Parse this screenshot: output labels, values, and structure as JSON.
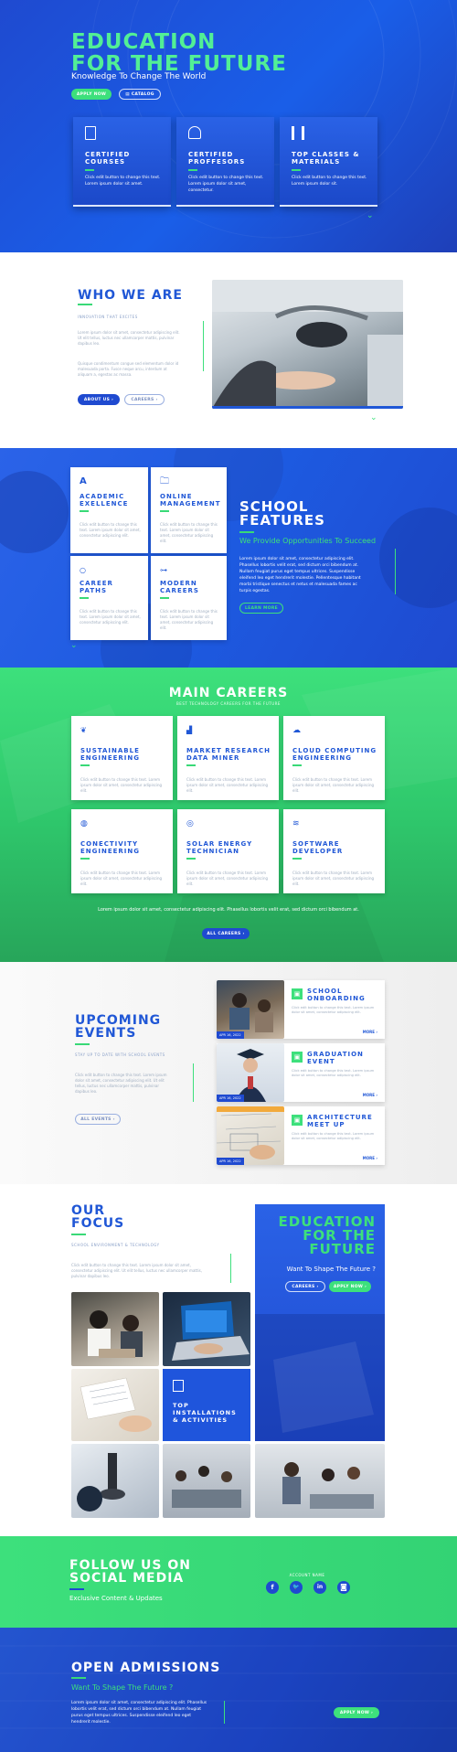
{
  "hero": {
    "title_1": "EDUCATION",
    "title_2": "FOR THE FUTURE",
    "subtitle": "Knowledge To Change The World",
    "btn_apply": "APPLY NOW",
    "btn_catalog": "CATALOG",
    "cards": [
      {
        "icon": "certificate-icon",
        "title_1": "CERTIFIED",
        "title_2": "COURSES",
        "text_1": "Click edit button to change this text.",
        "text_2": "Lorem ipsum dolor sit amet."
      },
      {
        "icon": "professor-icon",
        "title_1": "CERTIFIED",
        "title_2": "PROFFESORS",
        "text_1": "Click edit button to change this text.",
        "text_2": "Lorem ipsum dolor sit amet, consectetur."
      },
      {
        "icon": "books-icon",
        "title_1": "TOP CLASSES &",
        "title_2": "MATERIALS",
        "text_1": "Click edit button to change this text.",
        "text_2": "Lorem ipsum dolor sit."
      }
    ]
  },
  "about": {
    "title": "WHO WE ARE",
    "caption": "INNOVATION THAT EXCITES",
    "p1": "Lorem ipsum dolor sit amet, consectetur adipiscing elit. Ut elit tellus, luctus nec ullamcorper mattis, pulvinar dapibus leo.",
    "p2": "Quisque condimentum congue sed elementum dolor id malesuada porta. Fusce neque arcu, interdum at aliquam a, egestas ac massa.",
    "btn_about": "ABOUT US",
    "btn_careers": "CAREERS"
  },
  "features": {
    "title_1": "SCHOOL",
    "title_2": "FEATURES",
    "subtitle": "We Provide Opportunities To Succeed",
    "text": "Lorem ipsum dolor sit amet, consectetur adipiscing elit. Phasellus lobortis velit erat, sed dictum orci bibendum at. Nullam feugiat purus eget tempus ultrices. Suspendisse eleifend leo eget hendrerit molestie. Pellentesque habitant morbi tristique senectus et netus et malesuada fames ac turpis egestas.",
    "btn": "LEARN MORE",
    "cards": [
      {
        "icon": "letter-a-icon",
        "title_1": "ACADEMIC",
        "title_2": "EXELLENCE",
        "text": "Click edit button to change this text. Lorem ipsum dolor sit amet, consectetur adipiscing elit."
      },
      {
        "icon": "folder-icon",
        "title_1": "ONLINE",
        "title_2": "MANAGEMENT",
        "text": "Click edit button to change this text. Lorem ipsum dolor sit amet, consectetur adipiscing elit."
      },
      {
        "icon": "circle-icon",
        "title_1": "CAREER",
        "title_2": "PATHS",
        "text": "Click edit button to change this text. Lorem ipsum dolor sit amet, consectetur adipiscing elit."
      },
      {
        "icon": "gamepad-icon",
        "title_1": "MODERN",
        "title_2": "CAREERS",
        "text": "Click edit button to change this text. Lorem ipsum dolor sit amet, consectetur adipiscing elit."
      }
    ]
  },
  "careers": {
    "title": "MAIN CAREERS",
    "caption": "BEST TECHNOLOGY CAREERS FOR THE FUTURE",
    "footer": "Lorem ipsum dolor sit amet, consectetur adipiscing elit. Phasellus lobortis velit erat, sed dictum orci bibendum at.",
    "btn": "ALL CAREERS",
    "cards": [
      {
        "icon": "leaf-icon",
        "title_1": "SUSTAINABLE",
        "title_2": "ENGINEERING",
        "text": "Click edit button to change this text. Lorem ipsum dolor sit amet, consectetur adipiscing elit."
      },
      {
        "icon": "chart-icon",
        "title_1": "MARKET RESEARCH",
        "title_2": "DATA MINER",
        "text": "Click edit button to change this text. Lorem ipsum dolor sit amet, consectetur adipiscing elit."
      },
      {
        "icon": "cloud-icon",
        "title_1": "CLOUD COMPUTING",
        "title_2": "ENGINEERING",
        "text": "Click edit button to change this text. Lorem ipsum dolor sit amet, consectetur adipiscing elit."
      },
      {
        "icon": "globe-icon",
        "title_1": "CONECTIVITY",
        "title_2": "ENGINEERING",
        "text": "Click edit button to change this text. Lorem ipsum dolor sit amet, consectetur adipiscing elit."
      },
      {
        "icon": "target-icon",
        "title_1": "SOLAR ENERGY",
        "title_2": "TECHNICIAN",
        "text": "Click edit button to change this text. Lorem ipsum dolor sit amet, consectetur adipiscing elit."
      },
      {
        "icon": "layers-icon",
        "title_1": "SOFTWARE",
        "title_2": "DEVELOPER",
        "text": "Click edit button to change this text. Lorem ipsum dolor sit amet, consectetur adipiscing elit."
      }
    ]
  },
  "events": {
    "title_1": "UPCOMING",
    "title_2": "EVENTS",
    "caption": "STAY UP TO DATE WITH SCHOOL EVENTS",
    "text": "Click edit button to change this text. Lorem ipsum dolor sit amet, consectetur adipiscing elit. Ut elit tellus, luctus nec ullamcorper mattis, pulvinar dapibus leo.",
    "btn": "ALL EVENTS",
    "items": [
      {
        "date": "APR 16, 2022",
        "title_1": "SCHOOL",
        "title_2": "ONBOARDING",
        "text": "Click edit button to change this text. Lorem ipsum dolor sit amet, consectetur adipiscing elit.",
        "more": "MORE"
      },
      {
        "date": "APR 16, 2022",
        "title_1": "GRADUATION",
        "title_2": "EVENT",
        "text": "Click edit button to change this text. Lorem ipsum dolor sit amet, consectetur adipiscing elit.",
        "more": "MORE"
      },
      {
        "date": "APR 16, 2022",
        "title_1": "ARCHITECTURE",
        "title_2": "MEET UP",
        "text": "Click edit button to change this text. Lorem ipsum dolor sit amet, consectetur adipiscing elit.",
        "more": "MORE"
      }
    ]
  },
  "focus": {
    "title_1": "OUR",
    "title_2": "FOCUS",
    "caption": "SCHOOL ENVIRONMENT & TECHNOLOGY",
    "text": "Click edit button to change this text. Lorem ipsum dolor sit amet, consectetur adipiscing elit. Ut elit tellus, luctus nec ullamcorper mattis, pulvinar dapibus leo.",
    "tile_title_1": "TOP",
    "tile_title_2": "INSTALLATIONS",
    "tile_title_3": "& ACTIVITIES",
    "promo_1": "EDUCATION",
    "promo_2": "FOR THE",
    "promo_3": "FUTURE",
    "promo_sub": "Want To Shape The Future ?",
    "btn_careers": "CAREERS",
    "btn_apply": "APPLY NOW"
  },
  "social": {
    "title_1": "FOLLOW US ON",
    "title_2": "SOCIAL MEDIA",
    "subtitle": "Exclusive Content & Updates",
    "label": "ACCOUNT NAME",
    "icons": [
      "facebook-icon",
      "twitter-icon",
      "linkedin-icon",
      "instagram-icon"
    ]
  },
  "admissions": {
    "title": "OPEN ADMISSIONS",
    "subtitle": "Want To Shape The Future ?",
    "text": "Lorem ipsum dolor sit amet, consectetur adipiscing elit. Phasellus lobortis velit erat, sed dictum orci bibendum at. Nullam feugiat purus eget tempus ultrices. Suspendisse eleifend leo eget hendrerit molestie.",
    "btn": "APPLY NOW"
  },
  "colors": {
    "blue": "#1f4ad0",
    "green": "#3de07c",
    "title_blue": "#2057d6"
  }
}
